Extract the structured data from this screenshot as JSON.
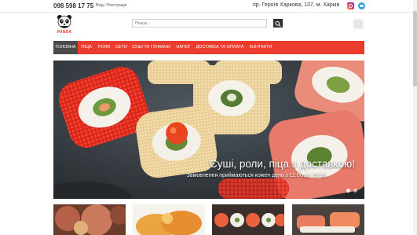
{
  "topbar": {
    "phone": "098 598 17 75",
    "login": "Вхід",
    "separator": "/",
    "register": "Реєстрація",
    "address": "пр. Героїв Харкова, 137, м. Харків",
    "social": [
      "instagram-icon",
      "twitter-icon"
    ]
  },
  "header": {
    "logo_text": "PANDA",
    "search_placeholder": "Пошук..."
  },
  "nav": {
    "items": [
      "ГОЛОВНА",
      "ПІЦА",
      "РОЛИ",
      "СЕТИ",
      "СУШІ ТА ГУНКАНИ",
      "НАПОЇ",
      "ДОСТАВКА ТА ОПЛАТА",
      "КОНТАКТИ"
    ],
    "active_index": 0
  },
  "hero": {
    "title": "Суші, роли, піца з доставкою!",
    "subtitle": "Замовлення приймаються кожен день з 11:00 до 19:30",
    "slides": 2,
    "active_slide": 0
  },
  "colors": {
    "accent": "#ec3c2e",
    "nav_active": "#4a4a4a",
    "text": "#333333"
  }
}
